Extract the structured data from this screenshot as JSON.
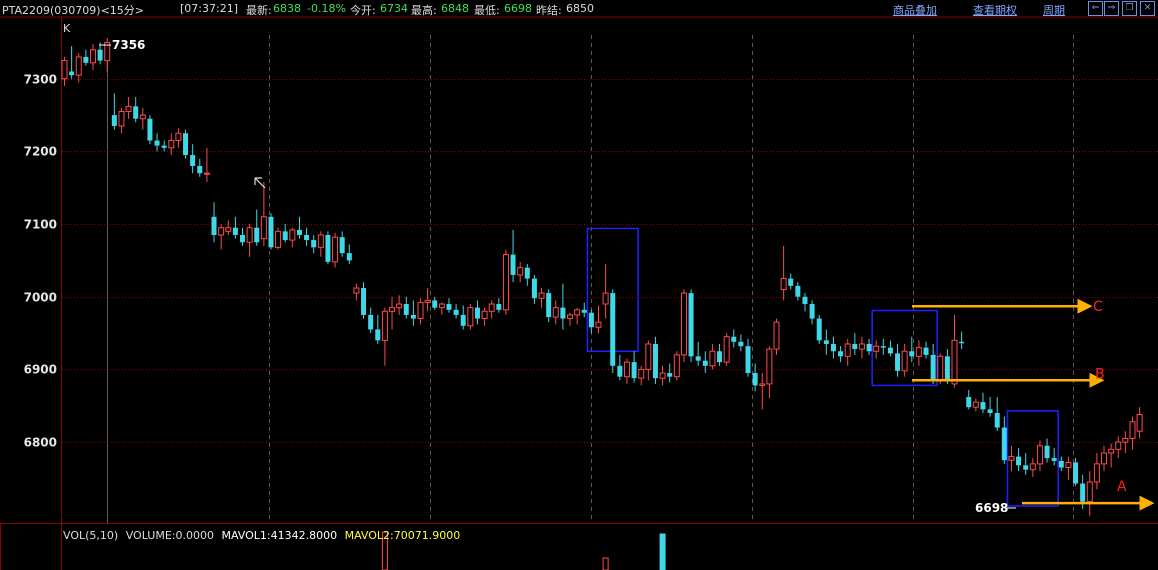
{
  "header": {
    "symbol": "PTA2209(030709)<15分>",
    "time": "[07:37:21]",
    "last_label": "最新:",
    "last_value": "6838",
    "change_value": "-0.18%",
    "open_label": "今开:",
    "open_value": "6734",
    "high_label": "最高:",
    "high_value": "6848",
    "low_label": "最低:",
    "low_value": "6698",
    "prev_label": "昨结:",
    "prev_value": "6850",
    "link_overlay": "商品叠加",
    "link_options": "查看期权",
    "link_period": "周期"
  },
  "chart_label": "K",
  "volume_panel": {
    "title": "VOL(5,10)",
    "volume": "VOLUME:0.0000",
    "mavol1": "MAVOL1:41342.8000",
    "mavol2": "MAVOL2:70071.9000"
  },
  "colors": {
    "up": "#ff4a4a",
    "down": "#3fd8e8",
    "grid": "#8b0000",
    "box": "#2020ff",
    "arrow": "#ffb000",
    "annot": "#ff2020"
  },
  "chart_data": {
    "type": "candlestick",
    "ylim": [
      6690,
      7385
    ],
    "yticks": [
      6800,
      6900,
      7000,
      7100,
      7200,
      7300
    ],
    "high_annotation": "7356",
    "low_annotation": "6698",
    "annotations": [
      "A",
      "B",
      "C"
    ],
    "lines": {
      "C": 6987,
      "B": 6885,
      "A": 6716
    },
    "boxes": [
      {
        "from": 74,
        "to": 80,
        "top": 7094,
        "bottom": 6925
      },
      {
        "from": 114,
        "to": 122,
        "top": 6981,
        "bottom": 6878
      },
      {
        "from": 133,
        "to": 139,
        "top": 6843,
        "bottom": 6712
      }
    ],
    "candles": [
      [
        7300,
        7330,
        7290,
        7325
      ],
      [
        7310,
        7345,
        7300,
        7305
      ],
      [
        7305,
        7335,
        7295,
        7330
      ],
      [
        7330,
        7340,
        7318,
        7322
      ],
      [
        7322,
        7348,
        7312,
        7340
      ],
      [
        7340,
        7350,
        7320,
        7325
      ],
      [
        7325,
        7356,
        7310,
        7350
      ],
      [
        7250,
        7280,
        7230,
        7235
      ],
      [
        7235,
        7260,
        7225,
        7255
      ],
      [
        7255,
        7275,
        7245,
        7262
      ],
      [
        7262,
        7275,
        7240,
        7245
      ],
      [
        7245,
        7260,
        7230,
        7250
      ],
      [
        7245,
        7250,
        7210,
        7215
      ],
      [
        7215,
        7225,
        7200,
        7208
      ],
      [
        7208,
        7215,
        7200,
        7205
      ],
      [
        7205,
        7225,
        7195,
        7215
      ],
      [
        7215,
        7232,
        7205,
        7225
      ],
      [
        7225,
        7230,
        7190,
        7195
      ],
      [
        7195,
        7210,
        7170,
        7180
      ],
      [
        7180,
        7190,
        7165,
        7170
      ],
      [
        7170,
        7205,
        7158,
        7170
      ],
      [
        7110,
        7130,
        7075,
        7085
      ],
      [
        7085,
        7100,
        7065,
        7095
      ],
      [
        7090,
        7105,
        7085,
        7095
      ],
      [
        7095,
        7110,
        7080,
        7085
      ],
      [
        7085,
        7095,
        7070,
        7075
      ],
      [
        7075,
        7100,
        7055,
        7095
      ],
      [
        7095,
        7120,
        7070,
        7075
      ],
      [
        7080,
        7158,
        7070,
        7110
      ],
      [
        7110,
        7115,
        7065,
        7068
      ],
      [
        7068,
        7095,
        7065,
        7090
      ],
      [
        7090,
        7100,
        7075,
        7078
      ],
      [
        7078,
        7095,
        7068,
        7092
      ],
      [
        7092,
        7110,
        7080,
        7085
      ],
      [
        7085,
        7095,
        7070,
        7078
      ],
      [
        7078,
        7085,
        7060,
        7068
      ],
      [
        7068,
        7090,
        7055,
        7085
      ],
      [
        7085,
        7090,
        7045,
        7048
      ],
      [
        7048,
        7088,
        7040,
        7082
      ],
      [
        7082,
        7090,
        7055,
        7060
      ],
      [
        7060,
        7072,
        7045,
        7050
      ],
      [
        7005,
        7018,
        6995,
        7012
      ],
      [
        7012,
        7020,
        6970,
        6975
      ],
      [
        6975,
        6985,
        6950,
        6955
      ],
      [
        6955,
        6975,
        6935,
        6940
      ],
      [
        6940,
        6985,
        6905,
        6980
      ],
      [
        6980,
        7000,
        6955,
        6985
      ],
      [
        6985,
        7002,
        6975,
        6990
      ],
      [
        6990,
        7000,
        6970,
        6975
      ],
      [
        6975,
        6995,
        6960,
        6970
      ],
      [
        6970,
        6998,
        6962,
        6992
      ],
      [
        6992,
        7012,
        6980,
        6995
      ],
      [
        6995,
        7000,
        6982,
        6985
      ],
      [
        6985,
        6992,
        6975,
        6990
      ],
      [
        6990,
        6998,
        6978,
        6982
      ],
      [
        6982,
        6990,
        6970,
        6975
      ],
      [
        6975,
        6988,
        6955,
        6960
      ],
      [
        6960,
        6990,
        6955,
        6985
      ],
      [
        6985,
        6995,
        6962,
        6970
      ],
      [
        6970,
        6985,
        6960,
        6980
      ],
      [
        6980,
        6995,
        6970,
        6990
      ],
      [
        6990,
        6998,
        6978,
        6982
      ],
      [
        6982,
        7065,
        6975,
        7058
      ],
      [
        7058,
        7092,
        7020,
        7030
      ],
      [
        7030,
        7048,
        7020,
        7040
      ],
      [
        7040,
        7045,
        7015,
        7025
      ],
      [
        7025,
        7030,
        6990,
        6998
      ],
      [
        6998,
        7012,
        6985,
        7005
      ],
      [
        7005,
        7010,
        6965,
        6972
      ],
      [
        6972,
        6995,
        6962,
        6985
      ],
      [
        6985,
        7018,
        6955,
        6970
      ],
      [
        6970,
        6978,
        6960,
        6975
      ],
      [
        6975,
        6985,
        6962,
        6982
      ],
      [
        6982,
        6992,
        6972,
        6978
      ],
      [
        6978,
        6982,
        6950,
        6958
      ],
      [
        6958,
        6988,
        6950,
        6965
      ],
      [
        6990,
        7045,
        6970,
        7005
      ],
      [
        7005,
        7010,
        6895,
        6905
      ],
      [
        6905,
        6920,
        6885,
        6890
      ],
      [
        6890,
        6915,
        6880,
        6910
      ],
      [
        6910,
        6925,
        6882,
        6888
      ],
      [
        6888,
        6905,
        6878,
        6900
      ],
      [
        6900,
        6940,
        6885,
        6935
      ],
      [
        6935,
        6945,
        6880,
        6888
      ],
      [
        6888,
        6905,
        6878,
        6895
      ],
      [
        6895,
        6908,
        6882,
        6890
      ],
      [
        6890,
        6925,
        6885,
        6920
      ],
      [
        6920,
        7010,
        6910,
        7005
      ],
      [
        7005,
        7010,
        6910,
        6918
      ],
      [
        6918,
        6938,
        6905,
        6912
      ],
      [
        6912,
        6925,
        6895,
        6905
      ],
      [
        6905,
        6935,
        6900,
        6925
      ],
      [
        6925,
        6935,
        6905,
        6910
      ],
      [
        6910,
        6950,
        6905,
        6945
      ],
      [
        6945,
        6955,
        6930,
        6938
      ],
      [
        6938,
        6948,
        6925,
        6932
      ],
      [
        6932,
        6942,
        6890,
        6895
      ],
      [
        6895,
        6908,
        6870,
        6878
      ],
      [
        6878,
        6895,
        6845,
        6880
      ],
      [
        6880,
        6932,
        6860,
        6928
      ],
      [
        6928,
        6970,
        6920,
        6965
      ],
      [
        7010,
        7070,
        6995,
        7025
      ],
      [
        7025,
        7032,
        7010,
        7015
      ],
      [
        7015,
        7020,
        6995,
        7000
      ],
      [
        7000,
        7005,
        6980,
        6990
      ],
      [
        6990,
        6995,
        6962,
        6970
      ],
      [
        6970,
        6975,
        6935,
        6940
      ],
      [
        6940,
        6955,
        6920,
        6935
      ],
      [
        6935,
        6945,
        6915,
        6925
      ],
      [
        6925,
        6932,
        6910,
        6918
      ],
      [
        6918,
        6942,
        6905,
        6935
      ],
      [
        6935,
        6950,
        6920,
        6928
      ],
      [
        6928,
        6945,
        6915,
        6935
      ],
      [
        6935,
        6942,
        6920,
        6925
      ],
      [
        6925,
        6940,
        6915,
        6932
      ],
      [
        6932,
        6942,
        6920,
        6930
      ],
      [
        6930,
        6940,
        6918,
        6922
      ],
      [
        6922,
        6935,
        6890,
        6898
      ],
      [
        6898,
        6935,
        6890,
        6925
      ],
      [
        6925,
        6945,
        6910,
        6918
      ],
      [
        6918,
        6940,
        6905,
        6930
      ],
      [
        6930,
        6938,
        6915,
        6920
      ],
      [
        6920,
        6935,
        6880,
        6885
      ],
      [
        6885,
        6922,
        6880,
        6918
      ],
      [
        6918,
        6928,
        6880,
        6885
      ],
      [
        6880,
        6975,
        6875,
        6940
      ],
      [
        6938,
        6952,
        6928,
        6936
      ],
      [
        6862,
        6872,
        6845,
        6848
      ],
      [
        6848,
        6860,
        6842,
        6855
      ],
      [
        6855,
        6868,
        6840,
        6845
      ],
      [
        6845,
        6862,
        6835,
        6840
      ],
      [
        6840,
        6862,
        6815,
        6820
      ],
      [
        6820,
        6835,
        6770,
        6775
      ],
      [
        6775,
        6795,
        6760,
        6780
      ],
      [
        6780,
        6792,
        6760,
        6768
      ],
      [
        6768,
        6785,
        6755,
        6762
      ],
      [
        6762,
        6778,
        6752,
        6770
      ],
      [
        6770,
        6802,
        6760,
        6795
      ],
      [
        6795,
        6805,
        6772,
        6778
      ],
      [
        6778,
        6792,
        6768,
        6774
      ],
      [
        6774,
        6780,
        6760,
        6765
      ],
      [
        6765,
        6780,
        6748,
        6772
      ],
      [
        6772,
        6778,
        6740,
        6743
      ],
      [
        6743,
        6755,
        6708,
        6718
      ],
      [
        6718,
        6760,
        6698,
        6745
      ],
      [
        6745,
        6785,
        6735,
        6770
      ],
      [
        6770,
        6795,
        6760,
        6785
      ],
      [
        6785,
        6798,
        6765,
        6790
      ],
      [
        6790,
        6808,
        6778,
        6800
      ],
      [
        6800,
        6815,
        6785,
        6805
      ],
      [
        6805,
        6835,
        6790,
        6828
      ],
      [
        6815,
        6848,
        6805,
        6838
      ]
    ],
    "volume_bars": [
      {
        "index": 45,
        "value": 38,
        "dir": "up"
      },
      {
        "index": 76,
        "value": 12,
        "dir": "up"
      },
      {
        "index": 84,
        "value": 36,
        "dir": "down"
      }
    ]
  }
}
